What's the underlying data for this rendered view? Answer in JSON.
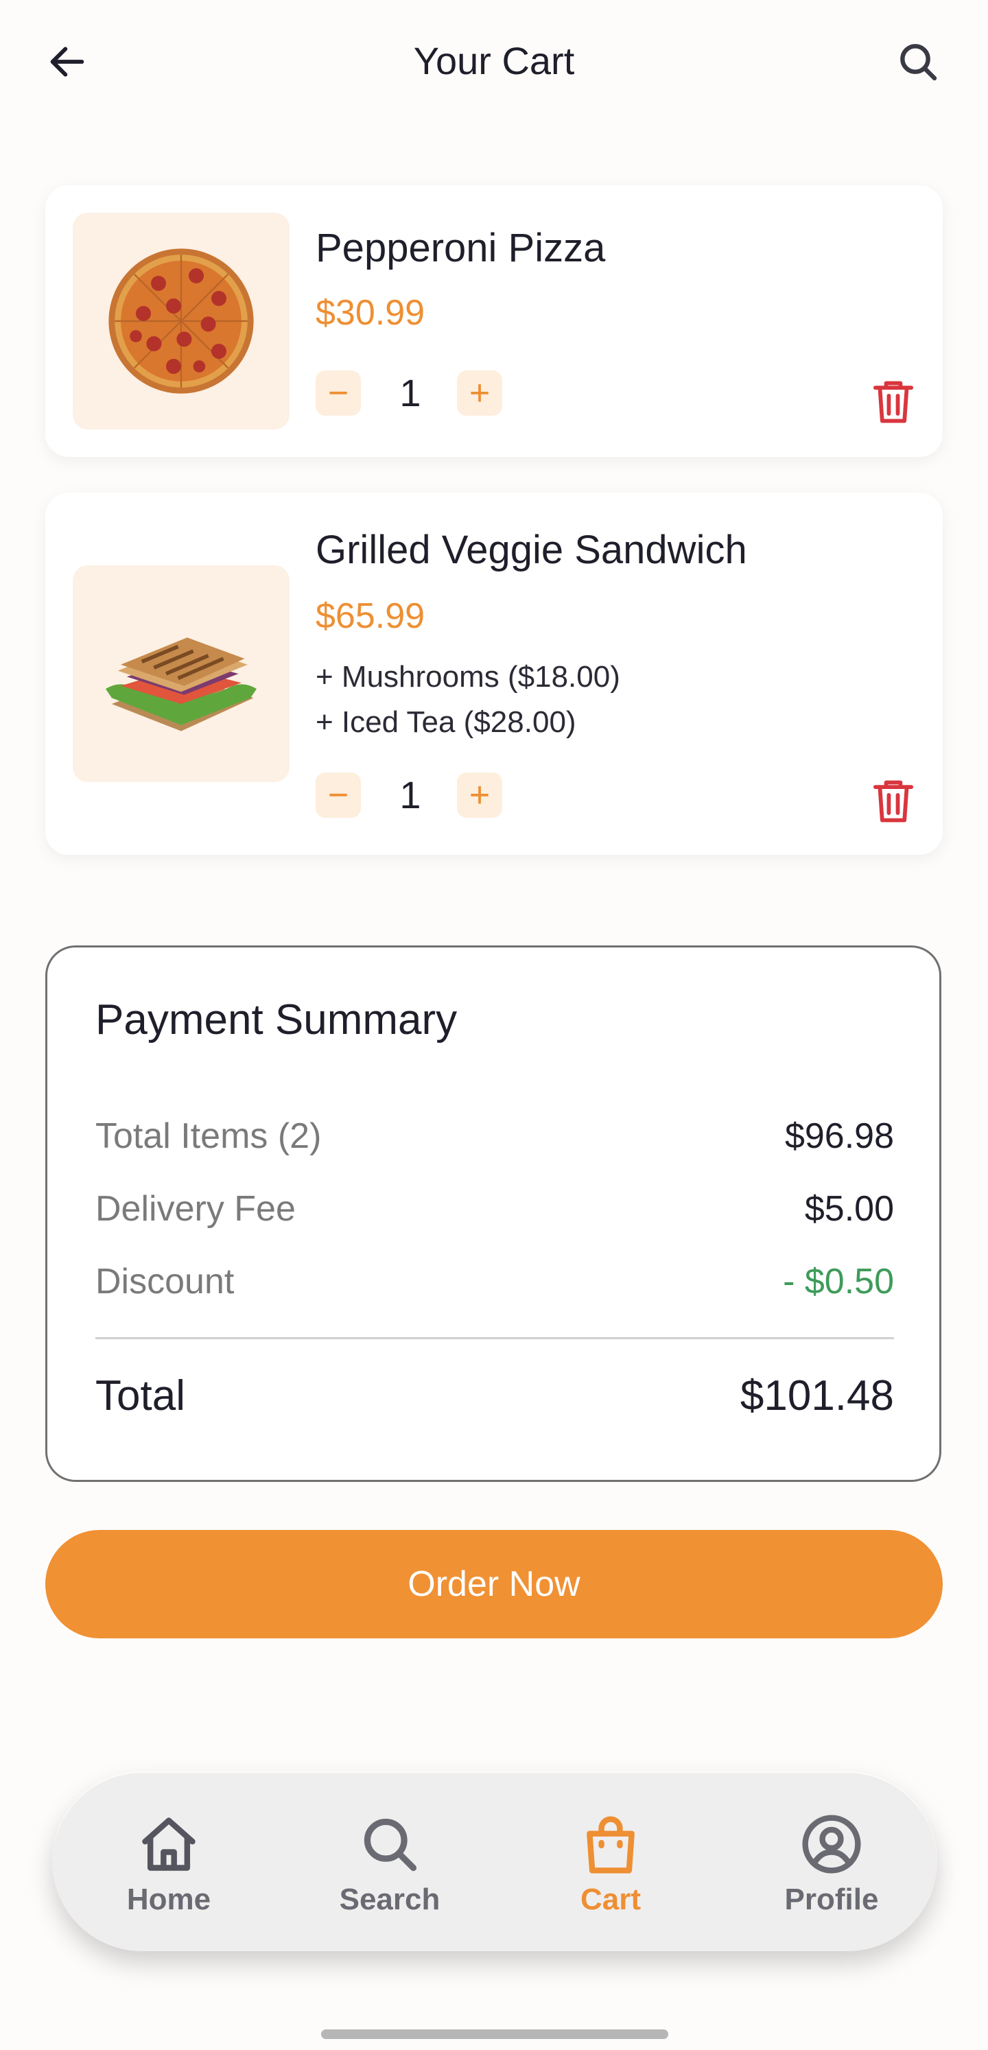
{
  "header": {
    "title": "Your Cart"
  },
  "cart": {
    "items": [
      {
        "name": "Pepperoni Pizza",
        "price": "$30.99",
        "addons": [],
        "quantity": "1"
      },
      {
        "name": "Grilled Veggie Sandwich",
        "price": "$65.99",
        "addons": [
          "+ Mushrooms ($18.00)",
          "+ Iced Tea ($28.00)"
        ],
        "quantity": "1"
      }
    ],
    "qty_minus": "−",
    "qty_plus": "+"
  },
  "summary": {
    "title": "Payment Summary",
    "rows": [
      {
        "label": "Total Items (2)",
        "value": "$96.98"
      },
      {
        "label": "Delivery Fee",
        "value": "$5.00"
      },
      {
        "label": "Discount",
        "value": "- $0.50"
      }
    ],
    "total_label": "Total",
    "total_value": "$101.48"
  },
  "order_button": {
    "label": "Order Now"
  },
  "nav": {
    "items": [
      {
        "label": "Home",
        "icon": "home-icon"
      },
      {
        "label": "Search",
        "icon": "search-icon"
      },
      {
        "label": "Cart",
        "icon": "shopping-bag-icon",
        "active": true
      },
      {
        "label": "Profile",
        "icon": "user-circle-icon"
      }
    ]
  },
  "colors": {
    "accent": "#f09134",
    "discount": "#3e9b5a",
    "delete": "#d9363e",
    "thumb_bg": "#fdf0e4"
  }
}
